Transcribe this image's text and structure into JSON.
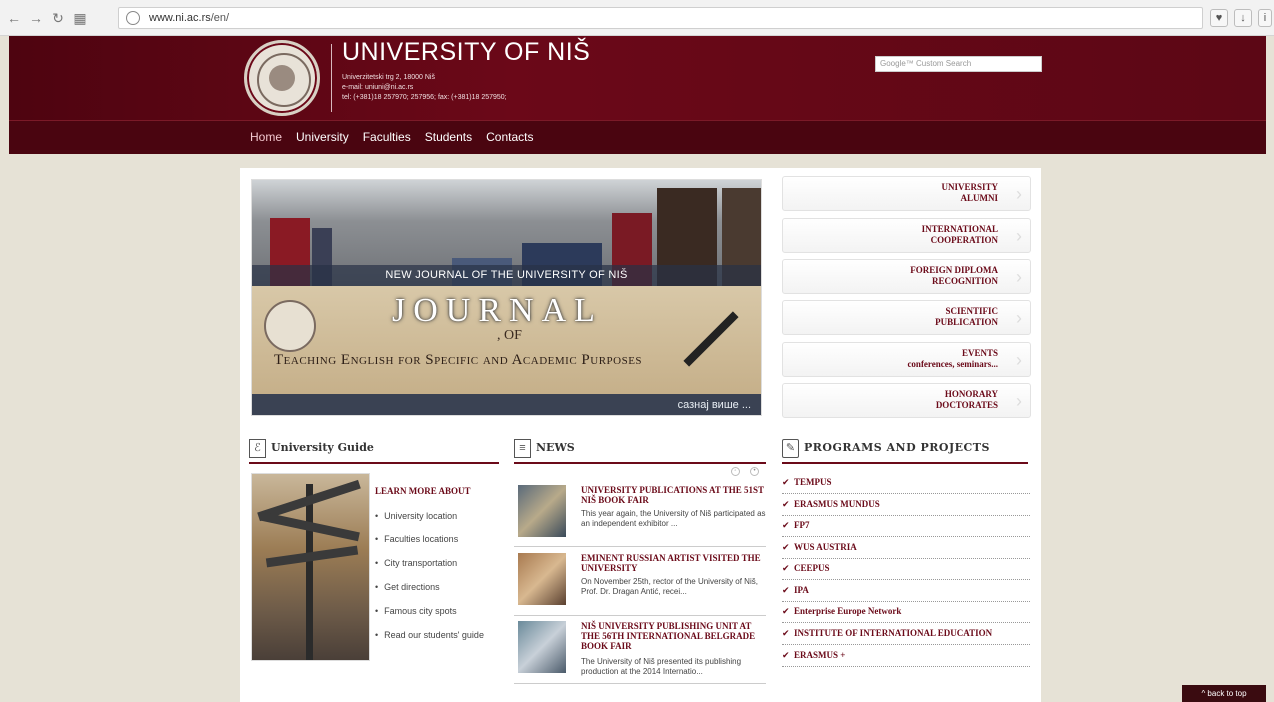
{
  "browser": {
    "url_host": "www.ni.ac.rs",
    "url_path": "/en/"
  },
  "header": {
    "title": "UNIVERSITY OF NIŠ",
    "address": "Univerzitetski trg 2, 18000 Niš",
    "email": "e-mail: uniuni@ni.ac.rs",
    "phone": "tel: (+381)18 257970; 257956; fax: (+381)18 257950;",
    "search_placeholder": "Google™ Custom Search",
    "nav": [
      "Home",
      "University",
      "Faculties",
      "Students",
      "Contacts"
    ]
  },
  "banner": {
    "caption": "NEW JOURNAL OF THE UNIVERSITY OF NIŠ",
    "journal_title": "JOURNAL",
    "journal_of": ", OF",
    "journal_subtitle": "Teaching English for Specific and Academic Purposes",
    "more_label": "сазнај више ..."
  },
  "quick_links": [
    {
      "line1": "UNIVERSITY",
      "line2": "ALUMNI"
    },
    {
      "line1": "INTERNATIONAL",
      "line2": "COOPERATION"
    },
    {
      "line1": "FOREIGN DIPLOMA",
      "line2": "RECOGNITION"
    },
    {
      "line1": "SCIENTIFIC",
      "line2": "PUBLICATION"
    },
    {
      "line1": "EVENTS",
      "line2": "conferences, seminars..."
    },
    {
      "line1": "HONORARY",
      "line2": "DOCTORATES"
    }
  ],
  "guide": {
    "heading": "University Guide",
    "learn_more": "LEARN MORE ABOUT",
    "items": [
      "University location",
      "Faculties locations",
      "City transportation",
      "Get directions",
      "Famous city spots",
      "Read our students' guide"
    ]
  },
  "news": {
    "heading": "NEWS",
    "items": [
      {
        "title": "UNIVERSITY PUBLICATIONS AT THE 51ST NIŠ BOOK FAIR",
        "desc": "This year again, the University of Niš participated as an independent exhibitor ..."
      },
      {
        "title": "EMINENT RUSSIAN ARTIST VISITED THE UNIVERSITY",
        "desc": "On November 25th, rector of the University of Niš, Prof. Dr. Dragan Antić, recei..."
      },
      {
        "title": "NIŠ UNIVERSITY PUBLISHING UNIT AT THE 56TH INTERNATIONAL BELGRADE BOOK FAIR",
        "desc": "The University of Niš presented its publishing production at the 2014 Internatio..."
      }
    ]
  },
  "programs": {
    "heading": "PROGRAMS AND PROJECTS",
    "items": [
      "TEMPUS",
      "ERASMUS MUNDUS",
      "FP7",
      "WUS AUSTRIA",
      "CEEPUS",
      "IPA",
      "Enterprise Europe Network",
      "INSTITUTE OF INTERNATIONAL EDUCATION",
      "ERASMUS +"
    ]
  },
  "back_to_top": "^ back to top",
  "colors": {
    "brand": "#6b0a19",
    "page_bg": "#e6e2d6"
  }
}
